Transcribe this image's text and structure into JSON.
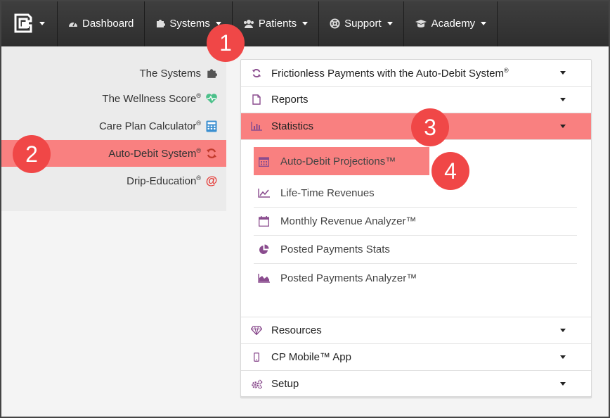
{
  "nav": {
    "items": [
      {
        "label": "Dashboard",
        "icon": "dashboard-icon",
        "caret": false
      },
      {
        "label": "Systems",
        "icon": "puzzle-icon",
        "caret": true
      },
      {
        "label": "Patients",
        "icon": "users-icon",
        "caret": true
      },
      {
        "label": "Support",
        "icon": "lifebuoy-icon",
        "caret": true
      },
      {
        "label": "Academy",
        "icon": "graduation-cap-icon",
        "caret": true
      }
    ]
  },
  "sidebar": {
    "items": [
      {
        "label": "The Systems",
        "reg": "",
        "icon": "puzzle-icon"
      },
      {
        "label": "The Wellness Score",
        "reg": "®",
        "icon": "heart-pulse-icon"
      },
      {
        "label": "Care Plan Calculator",
        "reg": "®",
        "icon": "calculator-icon"
      },
      {
        "label": "Auto-Debit System",
        "reg": "®",
        "icon": "refresh-icon"
      },
      {
        "label": "Drip-Education",
        "reg": "®",
        "icon": "at-sign-icon"
      }
    ]
  },
  "panel": {
    "sections": [
      {
        "label": "Frictionless Payments with the Auto-Debit System",
        "reg": "®",
        "icon": "refresh-icon"
      },
      {
        "label": "Reports",
        "reg": "",
        "icon": "document-icon"
      },
      {
        "label": "Statistics",
        "reg": "",
        "icon": "bar-chart-icon"
      },
      {
        "label": "Resources",
        "reg": "",
        "icon": "diamond-icon"
      },
      {
        "label": "CP Mobile™ App",
        "reg": "",
        "icon": "mobile-icon"
      },
      {
        "label": "Setup",
        "reg": "",
        "icon": "gears-icon"
      }
    ],
    "statistics_items": [
      {
        "label": "Auto-Debit Projections™",
        "icon": "calendar-icon"
      },
      {
        "label": "Life-Time Revenues",
        "icon": "line-chart-icon"
      },
      {
        "label": "Monthly Revenue Analyzer™",
        "icon": "calendar-outline-icon"
      },
      {
        "label": "Posted Payments Stats",
        "icon": "pie-chart-icon"
      },
      {
        "label": "Posted Payments Analyzer™",
        "icon": "area-chart-icon"
      }
    ]
  },
  "badges": [
    "1",
    "2",
    "3",
    "4"
  ],
  "colors": {
    "highlight": "#f98080",
    "badge": "#f04747",
    "icon_purple": "#8a4c8e",
    "nav_bg": "#333333"
  }
}
